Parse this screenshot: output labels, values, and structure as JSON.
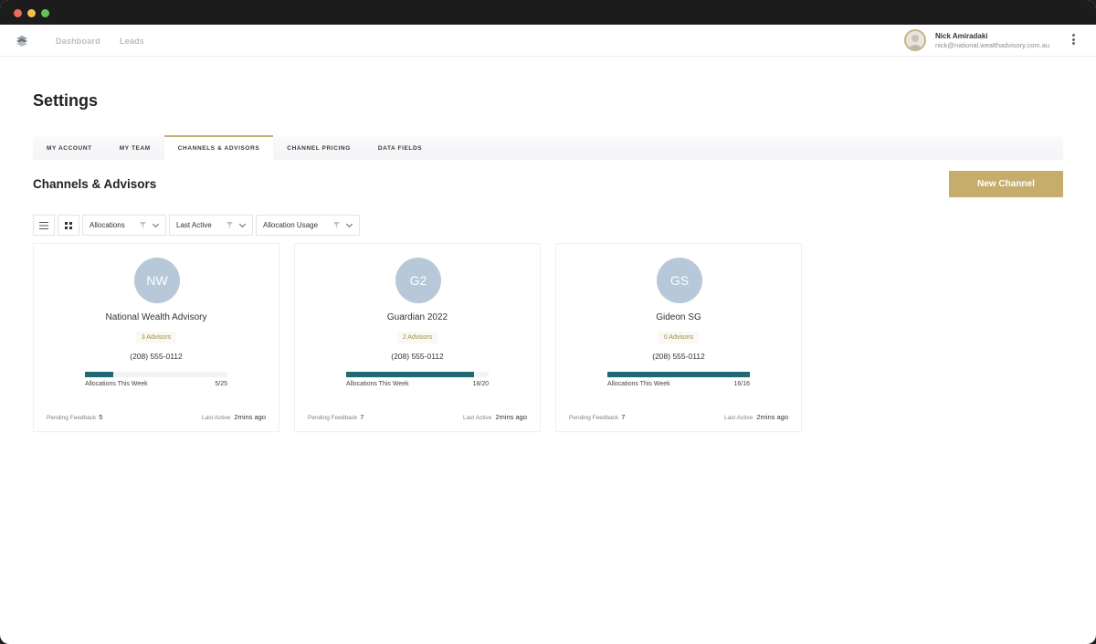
{
  "nav": {
    "links": [
      "Dashboard",
      "Leads"
    ],
    "user_name": "Nick Amiradaki",
    "user_email": "nick@national.wealthadvisory.com.au"
  },
  "page": {
    "title": "Settings",
    "tabs": [
      "MY ACCOUNT",
      "MY TEAM",
      "CHANNELS & ADVISORS",
      "CHANNEL PRICING",
      "DATA FIELDS"
    ],
    "active_tab": "CHANNELS & ADVISORS",
    "section_title": "Channels & Advisors",
    "new_channel_label": "New Channel"
  },
  "filters": [
    "Allocations",
    "Last Active",
    "Allocation Usage"
  ],
  "colors": {
    "accent_gold": "#c6ad6c",
    "progress_teal": "#1f6a73",
    "avatar_blue": "#b7c8d8"
  },
  "cards": [
    {
      "initials": "NW",
      "name": "National Wealth Advisory",
      "advisors": "3 Advisors",
      "phone": "(208) 555-0112",
      "alloc_label": "Allocations This Week",
      "alloc_text": "5/25",
      "alloc_fraction": 0.2,
      "pending_label": "Pending Feedback",
      "pending_value": "5",
      "last_label": "Last Active",
      "last_value": "2mins ago"
    },
    {
      "initials": "G2",
      "name": "Guardian 2022",
      "advisors": "2 Advisors",
      "phone": "(208) 555-0112",
      "alloc_label": "Allocations This Week",
      "alloc_text": "18/20",
      "alloc_fraction": 0.9,
      "pending_label": "Pending Feedback",
      "pending_value": "7",
      "last_label": "Last Active",
      "last_value": "2mins ago"
    },
    {
      "initials": "GS",
      "name": "Gideon SG",
      "advisors": "0 Advisors",
      "phone": "(208) 555-0112",
      "alloc_label": "Allocations This Week",
      "alloc_text": "16/16",
      "alloc_fraction": 1.0,
      "pending_label": "Pending Feedback",
      "pending_value": "7",
      "last_label": "Last Active",
      "last_value": "2mins ago"
    }
  ]
}
